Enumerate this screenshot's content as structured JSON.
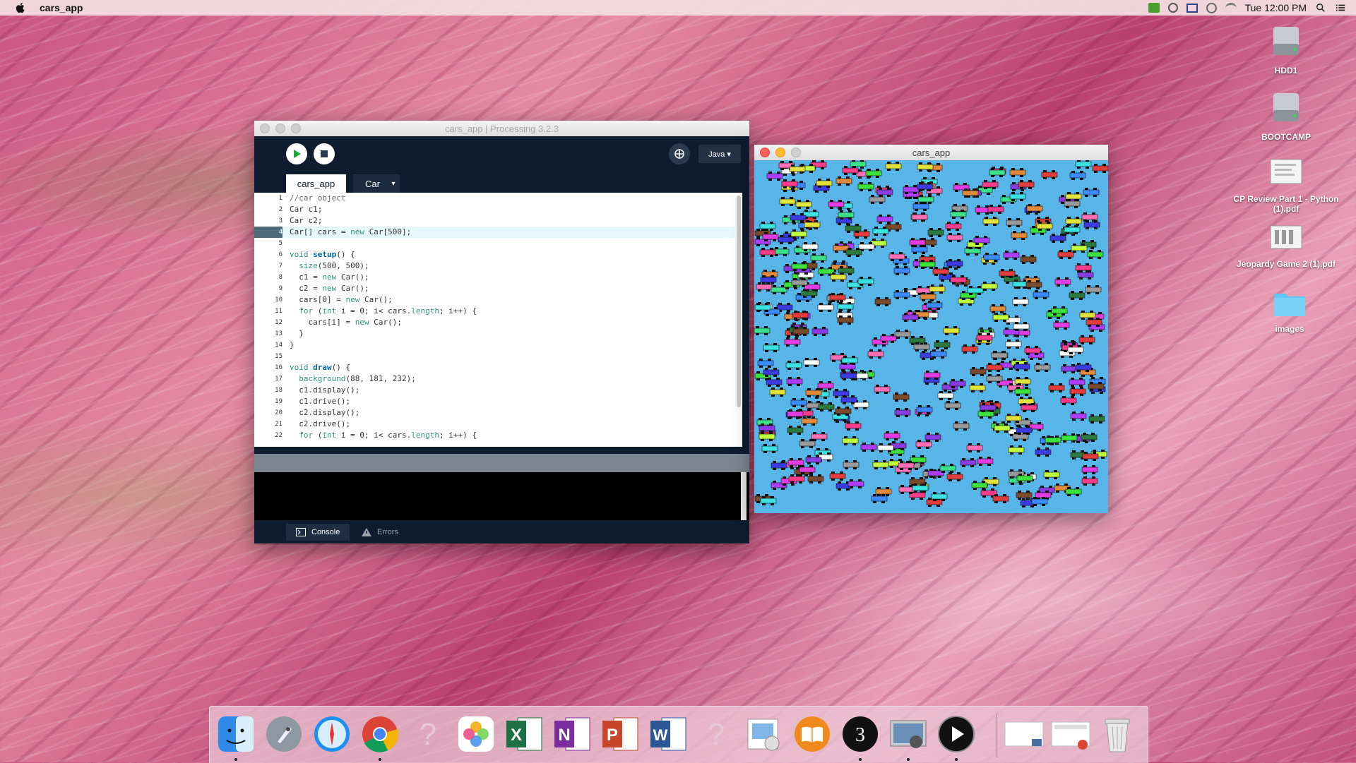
{
  "menubar": {
    "app_name": "cars_app",
    "clock": "Tue 12:00 PM",
    "icons": [
      "apple-icon",
      "android-icon",
      "sync-icon",
      "display-icon",
      "timemachine-icon",
      "wifi-icon",
      "spotlight-icon",
      "notification-center-icon"
    ]
  },
  "desktop": {
    "items": [
      {
        "label": "HDD1",
        "icon": "hard-drive-icon"
      },
      {
        "label": "BOOTCAMP",
        "icon": "hard-drive-icon"
      },
      {
        "label": "CP Review Part 1 - Python (1).pdf",
        "icon": "pdf-document-icon"
      },
      {
        "label": "Jeopardy Game 2 (1).pdf",
        "icon": "pdf-document-icon"
      },
      {
        "label": "images",
        "icon": "folder-icon"
      }
    ]
  },
  "processing": {
    "title": "cars_app | Processing 3.2.3",
    "mode": "Java ▾",
    "tabs": [
      "cars_app",
      "Car",
      "▾"
    ],
    "console_tab": "Console",
    "errors_tab": "Errors",
    "code": [
      {
        "n": "1",
        "t": "//car object"
      },
      {
        "n": "2",
        "t": "Car c1;"
      },
      {
        "n": "3",
        "t": "Car c2;"
      },
      {
        "n": "4",
        "t": "Car[] cars = new Car[500];"
      },
      {
        "n": "5",
        "t": ""
      },
      {
        "n": "6",
        "t": "void setup() {"
      },
      {
        "n": "7",
        "t": "  size(500, 500);"
      },
      {
        "n": "8",
        "t": "  c1 = new Car();"
      },
      {
        "n": "9",
        "t": "  c2 = new Car();"
      },
      {
        "n": "10",
        "t": "  cars[0] = new Car();"
      },
      {
        "n": "11",
        "t": "  for (int i = 0; i< cars.length; i++) {"
      },
      {
        "n": "12",
        "t": "    cars[i] = new Car();"
      },
      {
        "n": "13",
        "t": "  }"
      },
      {
        "n": "14",
        "t": "}"
      },
      {
        "n": "15",
        "t": ""
      },
      {
        "n": "16",
        "t": "void draw() {"
      },
      {
        "n": "17",
        "t": "  background(88, 181, 232);"
      },
      {
        "n": "18",
        "t": "  c1.display();"
      },
      {
        "n": "19",
        "t": "  c1.drive();"
      },
      {
        "n": "20",
        "t": "  c2.display();"
      },
      {
        "n": "21",
        "t": "  c2.drive();"
      },
      {
        "n": "22",
        "t": "  for (int i = 0; i< cars.length; i++) {"
      }
    ]
  },
  "sketch": {
    "title": "cars_app",
    "background": "#58b5e8",
    "car_colors": [
      "#e23c3c",
      "#3ce23c",
      "#3c3ce2",
      "#e2e23c",
      "#e23ce2",
      "#3ce2e2",
      "#e28a3c",
      "#8a3ce2",
      "#3ce28a",
      "#ffffff",
      "#ff6fb5",
      "#7a4a2a",
      "#9a9a9a",
      "#c0ff3c",
      "#3c8aff",
      "#ff3c8a",
      "#2c7a3c",
      "#b03cff"
    ]
  },
  "dock": {
    "apps": [
      "finder-icon",
      "launchpad-icon",
      "safari-icon",
      "chrome-icon",
      "unknown-app-icon",
      "photos-icon",
      "excel-icon",
      "onenote-icon",
      "powerpoint-icon",
      "word-icon",
      "unknown-app-icon",
      "preview-icon",
      "ibooks-icon",
      "processing-icon",
      "image-capture-icon",
      "quicktime-icon",
      "window-thumbnail-icon",
      "window-thumbnail-icon",
      "trash-icon"
    ]
  },
  "colors": {
    "processing_bg": "#0f1c2f",
    "keyword": "#33997e",
    "function": "#006699"
  }
}
